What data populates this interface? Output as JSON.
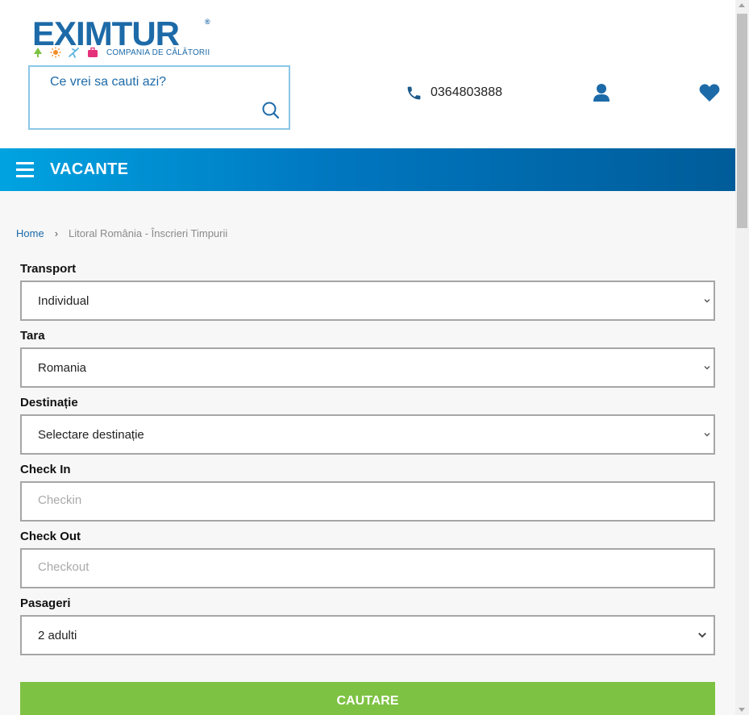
{
  "header": {
    "logo_text": "EXIMTUR",
    "logo_registered": "®",
    "logo_tagline": "COMPANIA DE CĂLĂTORII",
    "search_placeholder": "Ce vrei sa cauti azi?",
    "phone": "0364803888",
    "icons": {
      "search": "search-icon",
      "phone": "phone-icon",
      "user": "user-icon",
      "heart": "heart-icon"
    }
  },
  "navbar": {
    "title": "VACANTE",
    "menu_icon": "hamburger-menu-icon",
    "colors": {
      "start": "#00a3e0",
      "end": "#005c99"
    }
  },
  "breadcrumb": {
    "home": "Home",
    "separator": "›",
    "current": "Litoral România - Înscrieri Timpurii"
  },
  "form": {
    "transport": {
      "label": "Transport",
      "value": "Individual"
    },
    "tara": {
      "label": "Tara",
      "value": "Romania"
    },
    "destinatie": {
      "label": "Destinație",
      "value": "Selectare destinație"
    },
    "checkin": {
      "label": "Check In",
      "placeholder": "Checkin"
    },
    "checkout": {
      "label": "Check Out",
      "placeholder": "Checkout"
    },
    "pasageri": {
      "label": "Pasageri",
      "value": "2 adulti"
    },
    "submit_label": "CAUTARE"
  },
  "colors": {
    "brand_blue": "#1d6aa8",
    "submit_green": "#7dc242",
    "search_border": "#8cc7e6"
  }
}
